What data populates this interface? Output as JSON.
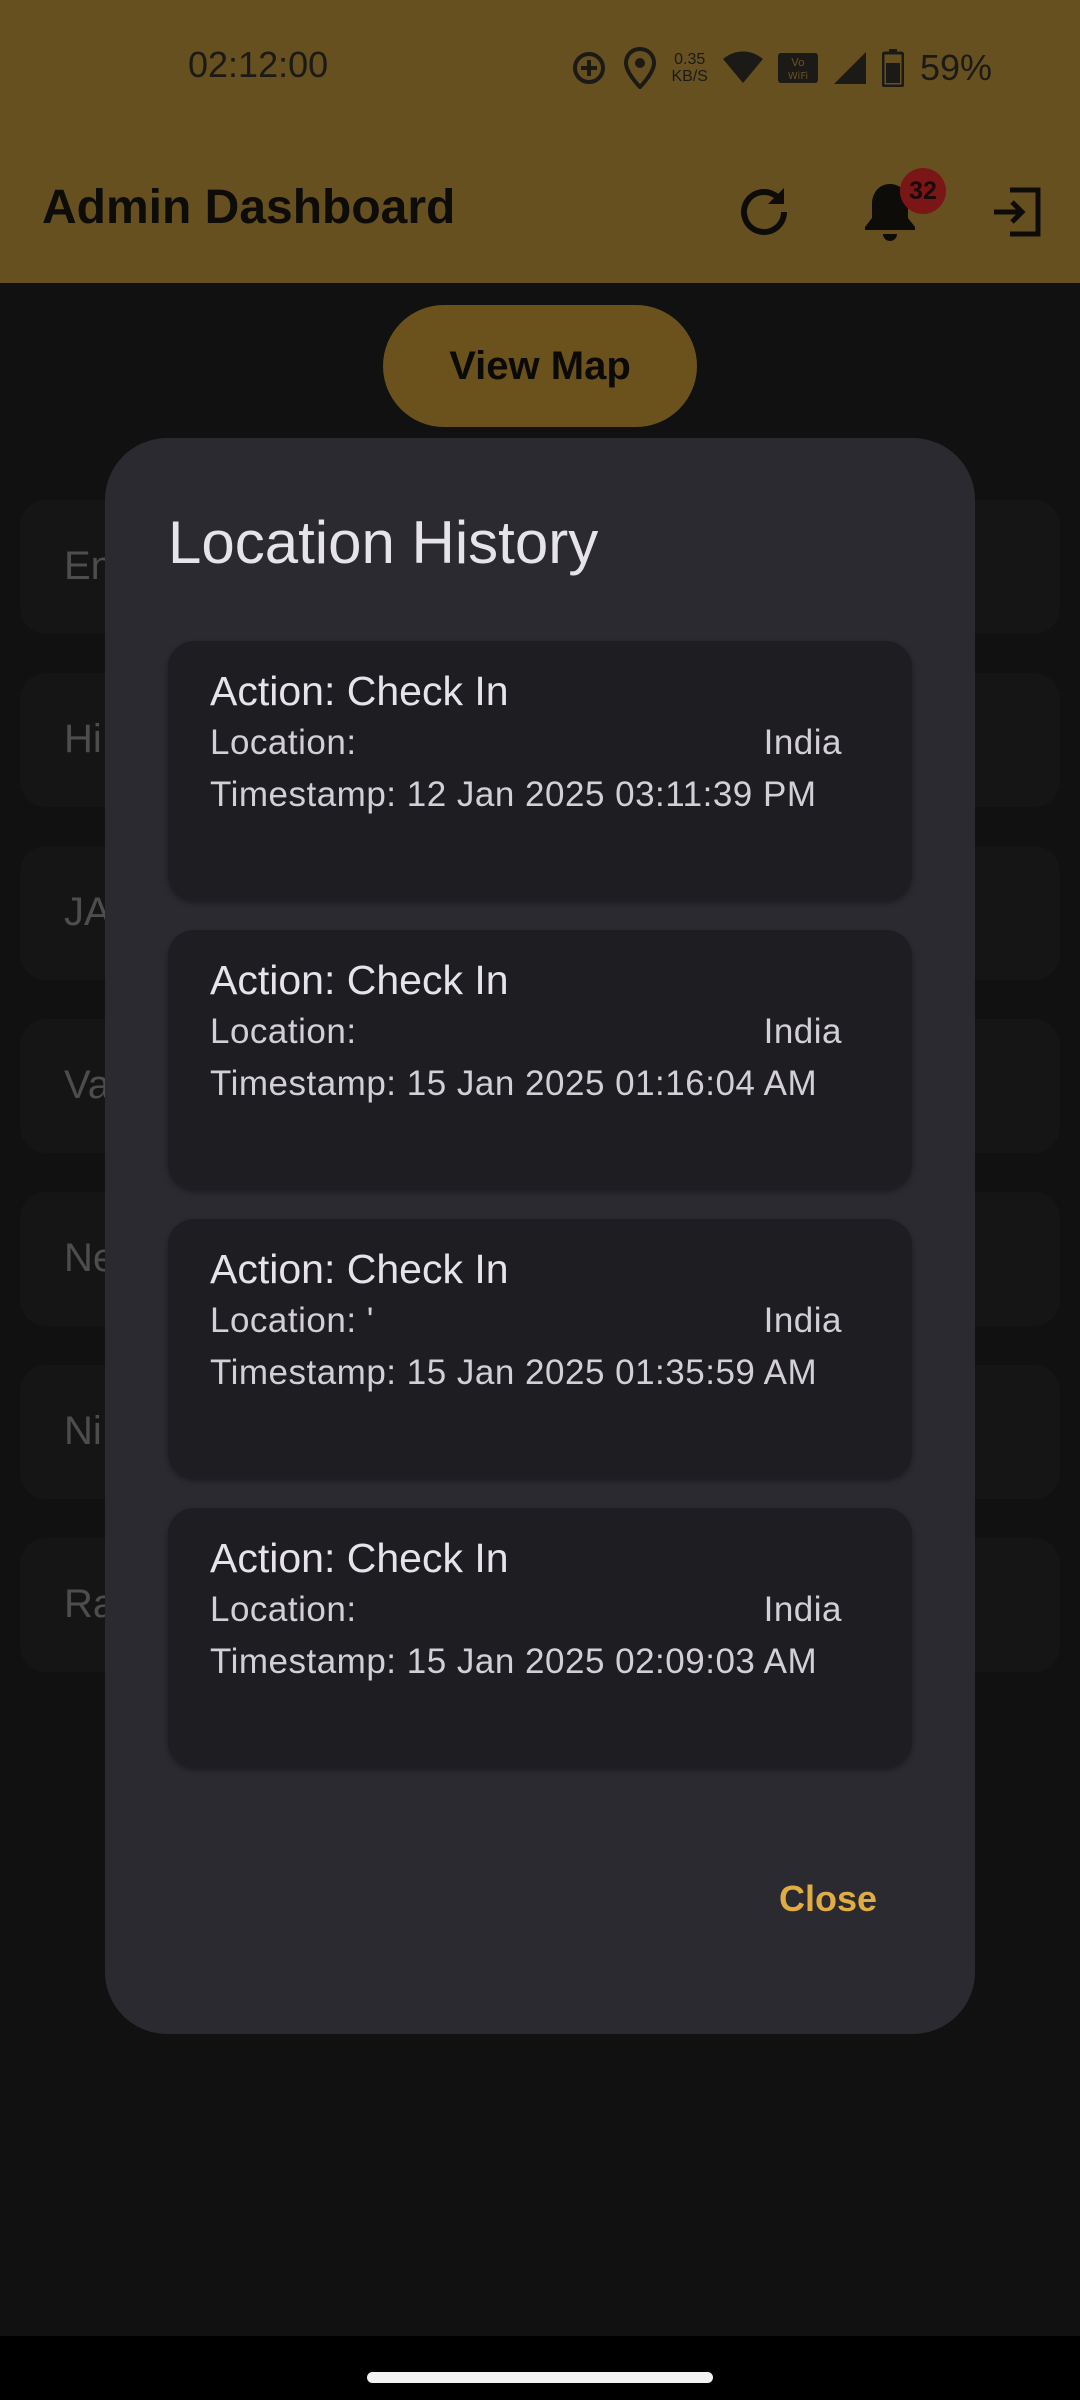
{
  "status_bar": {
    "time": "02:12:00",
    "net_speed_value": "0.35",
    "net_speed_unit": "KB/S",
    "wifi_badge": "Vo WiFi",
    "battery": "59%",
    "icons": [
      "data-saver-icon",
      "location-icon",
      "wifi-icon",
      "vowifi-icon",
      "signal-icon",
      "battery-icon"
    ]
  },
  "app_bar": {
    "title": "Admin Dashboard",
    "notification_count": "32",
    "icons": [
      "refresh-icon",
      "bell-icon",
      "logout-icon"
    ]
  },
  "background_page": {
    "view_map_label": "View Map",
    "employee_rows": [
      "En",
      "Hi",
      "JA",
      "Va",
      "Ne",
      "Ni",
      "Ra"
    ]
  },
  "dialog": {
    "title": "Location History",
    "close_label": "Close",
    "entries": [
      {
        "action": "Action: Check In",
        "location_label": "Location:",
        "location_value": "India",
        "timestamp": "Timestamp: 12 Jan 2025 03:11:39 PM"
      },
      {
        "action": "Action: Check In",
        "location_label": "Location:",
        "location_value": "India",
        "timestamp": "Timestamp: 15 Jan 2025 01:16:04 AM"
      },
      {
        "action": "Action: Check In",
        "location_label": "Location: '",
        "location_value": "India",
        "timestamp": "Timestamp: 15 Jan 2025 01:35:59 AM"
      },
      {
        "action": "Action: Check In",
        "location_label": "Location:",
        "location_value": "India",
        "timestamp": "Timestamp: 15 Jan 2025 02:09:03 AM"
      }
    ]
  },
  "colors": {
    "app_bar": "#67501f",
    "accent": "#e0ad42",
    "dialog_bg": "#2a2a30",
    "entry_bg": "#1e1e22",
    "badge": "#7a1616"
  }
}
